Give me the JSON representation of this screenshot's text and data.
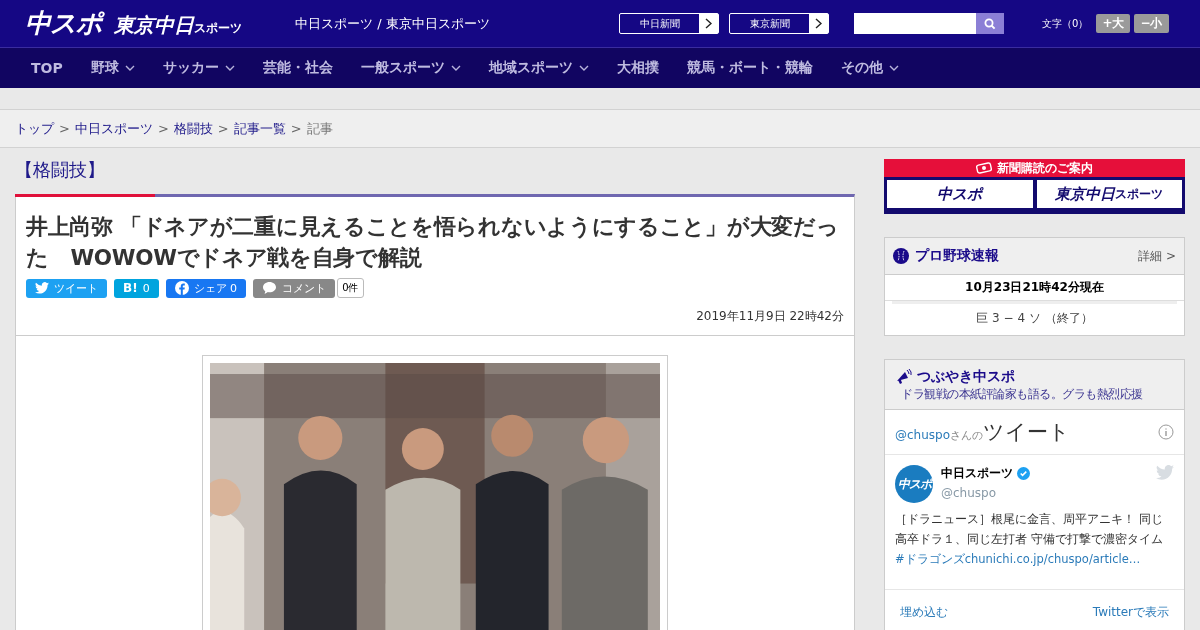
{
  "header": {
    "logo_main": "中スポ",
    "logo_tokyo": "東京中日",
    "logo_tokyo_sub": "スポーツ",
    "tagline": "中日スポーツ / 東京中日スポーツ",
    "paper_links": [
      {
        "label": "中日新聞"
      },
      {
        "label": "東京新聞"
      }
    ],
    "font_size": {
      "label": "文字（0）",
      "buttons": [
        "+大",
        "−小"
      ]
    }
  },
  "nav": [
    {
      "label": "TOP",
      "has_dropdown": false
    },
    {
      "label": "野球",
      "has_dropdown": true
    },
    {
      "label": "サッカー",
      "has_dropdown": true
    },
    {
      "label": "芸能・社会",
      "has_dropdown": false
    },
    {
      "label": "一般スポーツ",
      "has_dropdown": true
    },
    {
      "label": "地域スポーツ",
      "has_dropdown": true
    },
    {
      "label": "大相撲",
      "has_dropdown": false
    },
    {
      "label": "競馬・ボート・競輪",
      "has_dropdown": false
    },
    {
      "label": "その他",
      "has_dropdown": true
    }
  ],
  "breadcrumb": [
    {
      "label": "トップ",
      "current": false
    },
    {
      "sep": ">",
      "label": "中日スポーツ",
      "current": false
    },
    {
      "sep": ">",
      "label": "格闘技",
      "current": false
    },
    {
      "sep": ">",
      "label": "記事一覧",
      "current": false
    },
    {
      "sep": ">",
      "label": "記事",
      "current": true
    }
  ],
  "category": "【格闘技】",
  "article": {
    "title": "井上尚弥 「ドネアが二重に見えることを悟られないようにすること」が大変だった　WOWOWでドネア戦を自身で解説",
    "share": [
      {
        "kind": "twitter",
        "label": "ツイート"
      },
      {
        "kind": "hatena",
        "icon_text": "B!",
        "label": "0"
      },
      {
        "kind": "facebook",
        "label": "シェア 0"
      },
      {
        "kind": "comment",
        "label": "コメント"
      }
    ],
    "comment_count": "0件",
    "date": "2019年11月9日 22時42分"
  },
  "sidebar": {
    "subscribe": {
      "title": "新聞購読のご案内",
      "logos": [
        "中スポ",
        "東京中日"
      ],
      "logo_sub": "スポーツ"
    },
    "baseball": {
      "title": "プロ野球速報",
      "detail": "詳細 >",
      "updated": "10月23日21時42分現在",
      "games": [
        "巨 3 − 4 ソ （終了）"
      ]
    },
    "tweets": {
      "title": "つぶやき中スポ",
      "subtitle": "ドラ観戦の本紙評論家も語る。グラも熱烈応援",
      "handle": "@chuspo",
      "handle_suffix": "さんの",
      "heading": "ツイート",
      "tweet": {
        "name": "中日スポーツ",
        "verified": true,
        "user": "@chuspo",
        "avatar": "中スポ",
        "parts": [
          {
            "kind": "text",
            "text": "［ドラニュース］根尾に金言、周平アニキ！ 同じ高卒ドラ１、同じ左打者 守備で打撃で濃密タイム"
          },
          {
            "kind": "link",
            "text": "#ドラゴンズ"
          },
          {
            "kind": "link",
            "text": "chunichi.co.jp/chuspo/article…"
          }
        ]
      },
      "embed": "埋め込む",
      "view": "Twitterで表示"
    }
  }
}
